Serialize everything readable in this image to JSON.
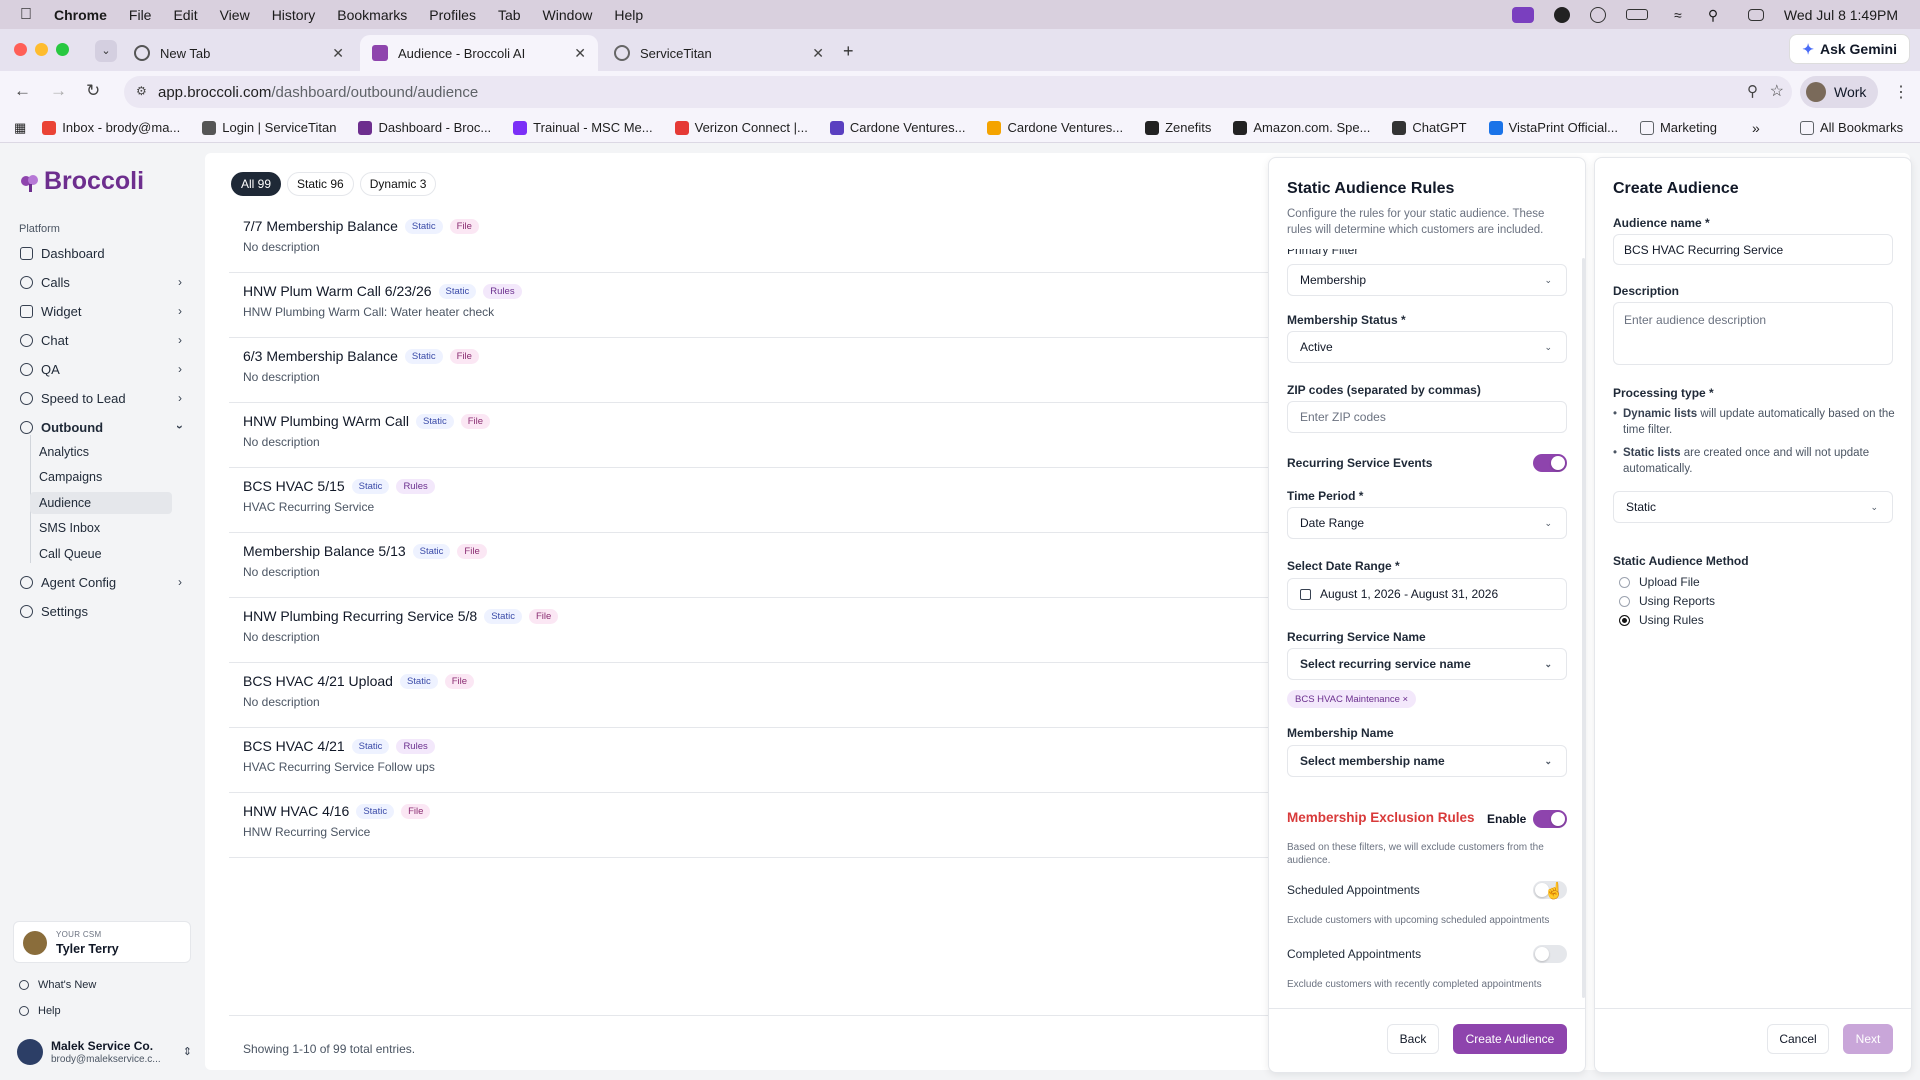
{
  "menubar": {
    "app": "Chrome",
    "items": [
      "File",
      "Edit",
      "View",
      "History",
      "Bookmarks",
      "Profiles",
      "Tab",
      "Window",
      "Help"
    ],
    "clock": "Wed Jul 8  1:49PM"
  },
  "tabs": [
    {
      "title": "New Tab",
      "active": false
    },
    {
      "title": "Audience - Broccoli AI",
      "active": true
    },
    {
      "title": "ServiceTitan",
      "active": false
    }
  ],
  "ask_gemini": "Ask Gemini",
  "address": {
    "host": "app.broccoli.com",
    "path": "/dashboard/outbound/audience"
  },
  "profile": "Work",
  "bookmarks": [
    {
      "label": "Inbox - brody@ma...",
      "color": "#ea4335"
    },
    {
      "label": "Login | ServiceTitan",
      "color": "#555555"
    },
    {
      "label": "Dashboard - Broc...",
      "color": "#6d2e8e"
    },
    {
      "label": "Trainual - MSC Me...",
      "color": "#7b2ff7"
    },
    {
      "label": "Verizon Connect |...",
      "color": "#e53935"
    },
    {
      "label": "Cardone Ventures...",
      "color": "#5a3fc0"
    },
    {
      "label": "Cardone Ventures...",
      "color": "#f4a300"
    },
    {
      "label": "Zenefits",
      "color": "#222222"
    },
    {
      "label": "Amazon.com. Spe...",
      "color": "#222222"
    },
    {
      "label": "ChatGPT",
      "color": "#333333"
    },
    {
      "label": "VistaPrint Official...",
      "color": "#1a73e8"
    },
    {
      "label": "Marketing",
      "color": "#5f6368"
    }
  ],
  "all_bookmarks": "All Bookmarks",
  "sidebar": {
    "brand": "Broccoli",
    "section": "Platform",
    "items": [
      {
        "label": "Dashboard",
        "chevron": false
      },
      {
        "label": "Calls",
        "chevron": true
      },
      {
        "label": "Widget",
        "chevron": true
      },
      {
        "label": "Chat",
        "chevron": true
      },
      {
        "label": "QA",
        "chevron": true
      },
      {
        "label": "Speed to Lead",
        "chevron": true
      },
      {
        "label": "Outbound",
        "chevron": true
      }
    ],
    "sub_items": [
      "Analytics",
      "Campaigns",
      "Audience",
      "SMS Inbox",
      "Call Queue"
    ],
    "after_items": [
      {
        "label": "Agent Config",
        "chevron": true
      },
      {
        "label": "Settings",
        "chevron": false
      }
    ],
    "csm_label": "YOUR CSM",
    "csm_name": "Tyler Terry",
    "whats_new": "What's New",
    "help": "Help",
    "org_name": "Malek Service Co.",
    "org_email": "brody@malekservice.c..."
  },
  "filters": [
    {
      "label": "All 99",
      "active": true
    },
    {
      "label": "Static 96",
      "active": false
    },
    {
      "label": "Dynamic 3",
      "active": false
    }
  ],
  "audiences": [
    {
      "title": "7/7 Membership Balance",
      "badges": [
        "Static",
        "File"
      ],
      "desc": "No description"
    },
    {
      "title": "HNW Plum Warm Call 6/23/26",
      "badges": [
        "Static",
        "Rules"
      ],
      "desc": "HNW Plumbing Warm Call: Water heater check"
    },
    {
      "title": "6/3 Membership Balance",
      "badges": [
        "Static",
        "File"
      ],
      "desc": "No description"
    },
    {
      "title": "HNW Plumbing WArm Call",
      "badges": [
        "Static",
        "File"
      ],
      "desc": "No description"
    },
    {
      "title": "BCS HVAC 5/15",
      "badges": [
        "Static",
        "Rules"
      ],
      "desc": "HVAC Recurring Service"
    },
    {
      "title": "Membership Balance 5/13",
      "badges": [
        "Static",
        "File"
      ],
      "desc": "No description"
    },
    {
      "title": "HNW Plumbing Recurring Service 5/8",
      "badges": [
        "Static",
        "File"
      ],
      "desc": "No description"
    },
    {
      "title": "BCS HVAC 4/21 Upload",
      "badges": [
        "Static",
        "File"
      ],
      "desc": "No description"
    },
    {
      "title": "BCS HVAC 4/21",
      "badges": [
        "Static",
        "Rules"
      ],
      "desc": "HVAC Recurring Service Follow ups"
    },
    {
      "title": "HNW HVAC 4/16",
      "badges": [
        "Static",
        "File"
      ],
      "desc": "HNW Recurring Service"
    }
  ],
  "showing": "Showing 1-10 of 99 total entries.",
  "rules": {
    "title": "Static Audience Rules",
    "subtitle": "Configure the rules for your static audience. These rules will determine which customers are included.",
    "primary_filter_label": "Primary Filter",
    "primary_filter_value": "Membership",
    "membership_status_label": "Membership Status *",
    "membership_status_value": "Active",
    "zip_label": "ZIP codes (separated by commas)",
    "zip_placeholder": "Enter ZIP codes",
    "recurring_events_label": "Recurring Service Events",
    "recurring_events_on": true,
    "time_period_label": "Time Period *",
    "time_period_value": "Date Range",
    "date_range_label": "Select Date Range *",
    "date_range_value": "August 1, 2026 - August 31, 2026",
    "recurring_name_label": "Recurring Service Name",
    "recurring_name_placeholder": "Select recurring service name",
    "recurring_chip": "BCS HVAC Maintenance ×",
    "membership_name_label": "Membership Name",
    "membership_name_placeholder": "Select membership name",
    "exclusion_title": "Membership Exclusion Rules",
    "exclusion_enable_label": "Enable",
    "exclusion_enabled": true,
    "exclusion_note": "Based on these filters, we will exclude customers from the audience.",
    "scheduled_label": "Scheduled Appointments",
    "scheduled_note": "Exclude customers with upcoming scheduled appointments",
    "scheduled_on": false,
    "completed_label": "Completed Appointments",
    "completed_note": "Exclude customers with recently completed appointments",
    "completed_on": false,
    "back": "Back",
    "create": "Create Audience"
  },
  "create": {
    "title": "Create Audience",
    "name_label": "Audience name *",
    "name_value": "BCS HVAC Recurring Service",
    "desc_label": "Description",
    "desc_placeholder": "Enter audience description",
    "processing_label": "Processing type *",
    "dynamic_bold": "Dynamic lists",
    "dynamic_text": " will update automatically based on the time filter.",
    "static_bold": "Static lists",
    "static_text": " are created once and will not update automatically.",
    "processing_value": "Static",
    "method_label": "Static Audience Method",
    "methods": [
      {
        "label": "Upload File",
        "checked": false
      },
      {
        "label": "Using Reports",
        "checked": false
      },
      {
        "label": "Using Rules",
        "checked": true
      }
    ],
    "cancel": "Cancel",
    "next": "Next"
  },
  "colors": {
    "accent": "#8e44ad",
    "brand": "#6d2e8e",
    "danger": "#d83a3a"
  }
}
